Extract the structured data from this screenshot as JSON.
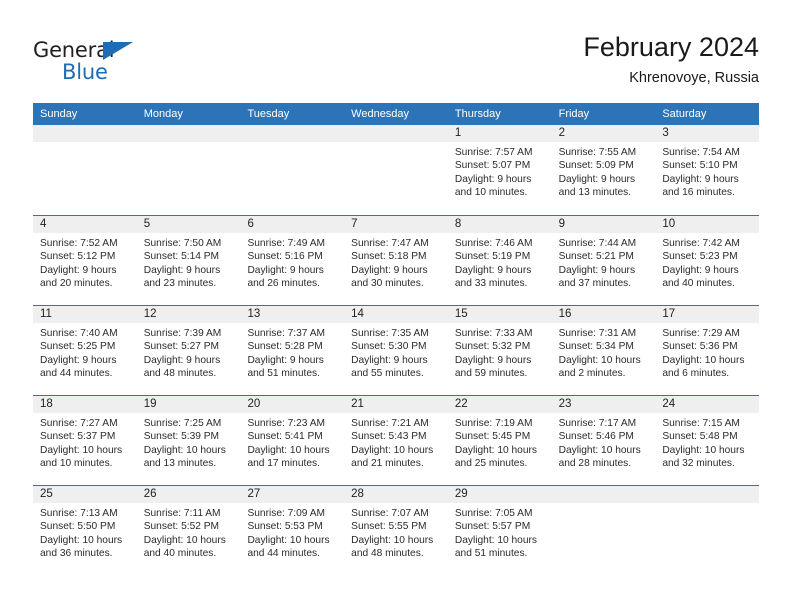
{
  "brand": {
    "line1": "General",
    "line2": "Blue",
    "triangle_color": "#1f6cb4",
    "text_color": "#231f20"
  },
  "header": {
    "title": "February 2024",
    "subtitle": "Khrenovoye, Russia"
  },
  "theme": {
    "header_blue": "#2c74b8",
    "daynum_band": "#efefef",
    "text": "#2b2b2b"
  },
  "calendar": {
    "day_headers": [
      "Sunday",
      "Monday",
      "Tuesday",
      "Wednesday",
      "Thursday",
      "Friday",
      "Saturday"
    ],
    "labels": {
      "sunrise": "Sunrise:",
      "sunset": "Sunset:",
      "daylight": "Daylight:"
    },
    "weeks": [
      [
        {
          "day": ""
        },
        {
          "day": ""
        },
        {
          "day": ""
        },
        {
          "day": ""
        },
        {
          "day": "1",
          "sunrise": "Sunrise: 7:57 AM",
          "sunset": "Sunset: 5:07 PM",
          "daylight": "Daylight: 9 hours and 10 minutes."
        },
        {
          "day": "2",
          "sunrise": "Sunrise: 7:55 AM",
          "sunset": "Sunset: 5:09 PM",
          "daylight": "Daylight: 9 hours and 13 minutes."
        },
        {
          "day": "3",
          "sunrise": "Sunrise: 7:54 AM",
          "sunset": "Sunset: 5:10 PM",
          "daylight": "Daylight: 9 hours and 16 minutes."
        }
      ],
      [
        {
          "day": "4",
          "sunrise": "Sunrise: 7:52 AM",
          "sunset": "Sunset: 5:12 PM",
          "daylight": "Daylight: 9 hours and 20 minutes."
        },
        {
          "day": "5",
          "sunrise": "Sunrise: 7:50 AM",
          "sunset": "Sunset: 5:14 PM",
          "daylight": "Daylight: 9 hours and 23 minutes."
        },
        {
          "day": "6",
          "sunrise": "Sunrise: 7:49 AM",
          "sunset": "Sunset: 5:16 PM",
          "daylight": "Daylight: 9 hours and 26 minutes."
        },
        {
          "day": "7",
          "sunrise": "Sunrise: 7:47 AM",
          "sunset": "Sunset: 5:18 PM",
          "daylight": "Daylight: 9 hours and 30 minutes."
        },
        {
          "day": "8",
          "sunrise": "Sunrise: 7:46 AM",
          "sunset": "Sunset: 5:19 PM",
          "daylight": "Daylight: 9 hours and 33 minutes."
        },
        {
          "day": "9",
          "sunrise": "Sunrise: 7:44 AM",
          "sunset": "Sunset: 5:21 PM",
          "daylight": "Daylight: 9 hours and 37 minutes."
        },
        {
          "day": "10",
          "sunrise": "Sunrise: 7:42 AM",
          "sunset": "Sunset: 5:23 PM",
          "daylight": "Daylight: 9 hours and 40 minutes."
        }
      ],
      [
        {
          "day": "11",
          "sunrise": "Sunrise: 7:40 AM",
          "sunset": "Sunset: 5:25 PM",
          "daylight": "Daylight: 9 hours and 44 minutes."
        },
        {
          "day": "12",
          "sunrise": "Sunrise: 7:39 AM",
          "sunset": "Sunset: 5:27 PM",
          "daylight": "Daylight: 9 hours and 48 minutes."
        },
        {
          "day": "13",
          "sunrise": "Sunrise: 7:37 AM",
          "sunset": "Sunset: 5:28 PM",
          "daylight": "Daylight: 9 hours and 51 minutes."
        },
        {
          "day": "14",
          "sunrise": "Sunrise: 7:35 AM",
          "sunset": "Sunset: 5:30 PM",
          "daylight": "Daylight: 9 hours and 55 minutes."
        },
        {
          "day": "15",
          "sunrise": "Sunrise: 7:33 AM",
          "sunset": "Sunset: 5:32 PM",
          "daylight": "Daylight: 9 hours and 59 minutes."
        },
        {
          "day": "16",
          "sunrise": "Sunrise: 7:31 AM",
          "sunset": "Sunset: 5:34 PM",
          "daylight": "Daylight: 10 hours and 2 minutes."
        },
        {
          "day": "17",
          "sunrise": "Sunrise: 7:29 AM",
          "sunset": "Sunset: 5:36 PM",
          "daylight": "Daylight: 10 hours and 6 minutes."
        }
      ],
      [
        {
          "day": "18",
          "sunrise": "Sunrise: 7:27 AM",
          "sunset": "Sunset: 5:37 PM",
          "daylight": "Daylight: 10 hours and 10 minutes."
        },
        {
          "day": "19",
          "sunrise": "Sunrise: 7:25 AM",
          "sunset": "Sunset: 5:39 PM",
          "daylight": "Daylight: 10 hours and 13 minutes."
        },
        {
          "day": "20",
          "sunrise": "Sunrise: 7:23 AM",
          "sunset": "Sunset: 5:41 PM",
          "daylight": "Daylight: 10 hours and 17 minutes."
        },
        {
          "day": "21",
          "sunrise": "Sunrise: 7:21 AM",
          "sunset": "Sunset: 5:43 PM",
          "daylight": "Daylight: 10 hours and 21 minutes."
        },
        {
          "day": "22",
          "sunrise": "Sunrise: 7:19 AM",
          "sunset": "Sunset: 5:45 PM",
          "daylight": "Daylight: 10 hours and 25 minutes."
        },
        {
          "day": "23",
          "sunrise": "Sunrise: 7:17 AM",
          "sunset": "Sunset: 5:46 PM",
          "daylight": "Daylight: 10 hours and 28 minutes."
        },
        {
          "day": "24",
          "sunrise": "Sunrise: 7:15 AM",
          "sunset": "Sunset: 5:48 PM",
          "daylight": "Daylight: 10 hours and 32 minutes."
        }
      ],
      [
        {
          "day": "25",
          "sunrise": "Sunrise: 7:13 AM",
          "sunset": "Sunset: 5:50 PM",
          "daylight": "Daylight: 10 hours and 36 minutes."
        },
        {
          "day": "26",
          "sunrise": "Sunrise: 7:11 AM",
          "sunset": "Sunset: 5:52 PM",
          "daylight": "Daylight: 10 hours and 40 minutes."
        },
        {
          "day": "27",
          "sunrise": "Sunrise: 7:09 AM",
          "sunset": "Sunset: 5:53 PM",
          "daylight": "Daylight: 10 hours and 44 minutes."
        },
        {
          "day": "28",
          "sunrise": "Sunrise: 7:07 AM",
          "sunset": "Sunset: 5:55 PM",
          "daylight": "Daylight: 10 hours and 48 minutes."
        },
        {
          "day": "29",
          "sunrise": "Sunrise: 7:05 AM",
          "sunset": "Sunset: 5:57 PM",
          "daylight": "Daylight: 10 hours and 51 minutes."
        },
        {
          "day": ""
        },
        {
          "day": ""
        }
      ]
    ]
  }
}
